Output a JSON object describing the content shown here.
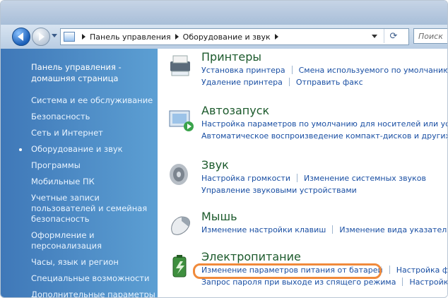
{
  "nav": {
    "search_placeholder": "Поиск",
    "breadcrumb": [
      "Панель управления",
      "Оборудование и звук"
    ]
  },
  "sidebar": {
    "home": "Панель управления - домашняя страница",
    "items": [
      "Система и ее обслуживание",
      "Безопасность",
      "Сеть и Интернет",
      "Оборудование и звук",
      "Программы",
      "Мобильные ПК",
      "Учетные записи пользователей и семейная безопасность",
      "Оформление и персонализация",
      "Часы, язык и регион",
      "Специальные возможности",
      "Дополнительные параметры"
    ],
    "active_index": 3
  },
  "categories": [
    {
      "title": "Принтеры",
      "links_row1": [
        "Установка принтера",
        "Смена используемого по умолчанию"
      ],
      "links_row2": [
        "Удаление принтера",
        "Отправить факс"
      ]
    },
    {
      "title": "Автозапуск",
      "links_row1": [
        "Настройка параметров по умолчанию для носителей или уст"
      ],
      "links_row2": [
        "Автоматическое воспроизведение компакт-дисков и других н"
      ]
    },
    {
      "title": "Звук",
      "links_row1": [
        "Настройка громкости",
        "Изменение системных звуков"
      ],
      "links_row2": [
        "Управление звуковыми устройствами"
      ]
    },
    {
      "title": "Мышь",
      "links_row1": [
        "Изменение настройки клавиш",
        "Изменение вида указателя"
      ]
    },
    {
      "title": "Электропитание",
      "links_row1": [
        "Изменение параметров питания от батарей",
        "Настройка фу"
      ],
      "links_row2": [
        "Запрос пароля при выходе из спящего режима",
        "Настройка"
      ]
    }
  ],
  "colors": {
    "sidebar": "#4c8bc7",
    "link": "#1a4fa3",
    "title": "#1c5a2c",
    "highlight": "#f08a3b"
  }
}
